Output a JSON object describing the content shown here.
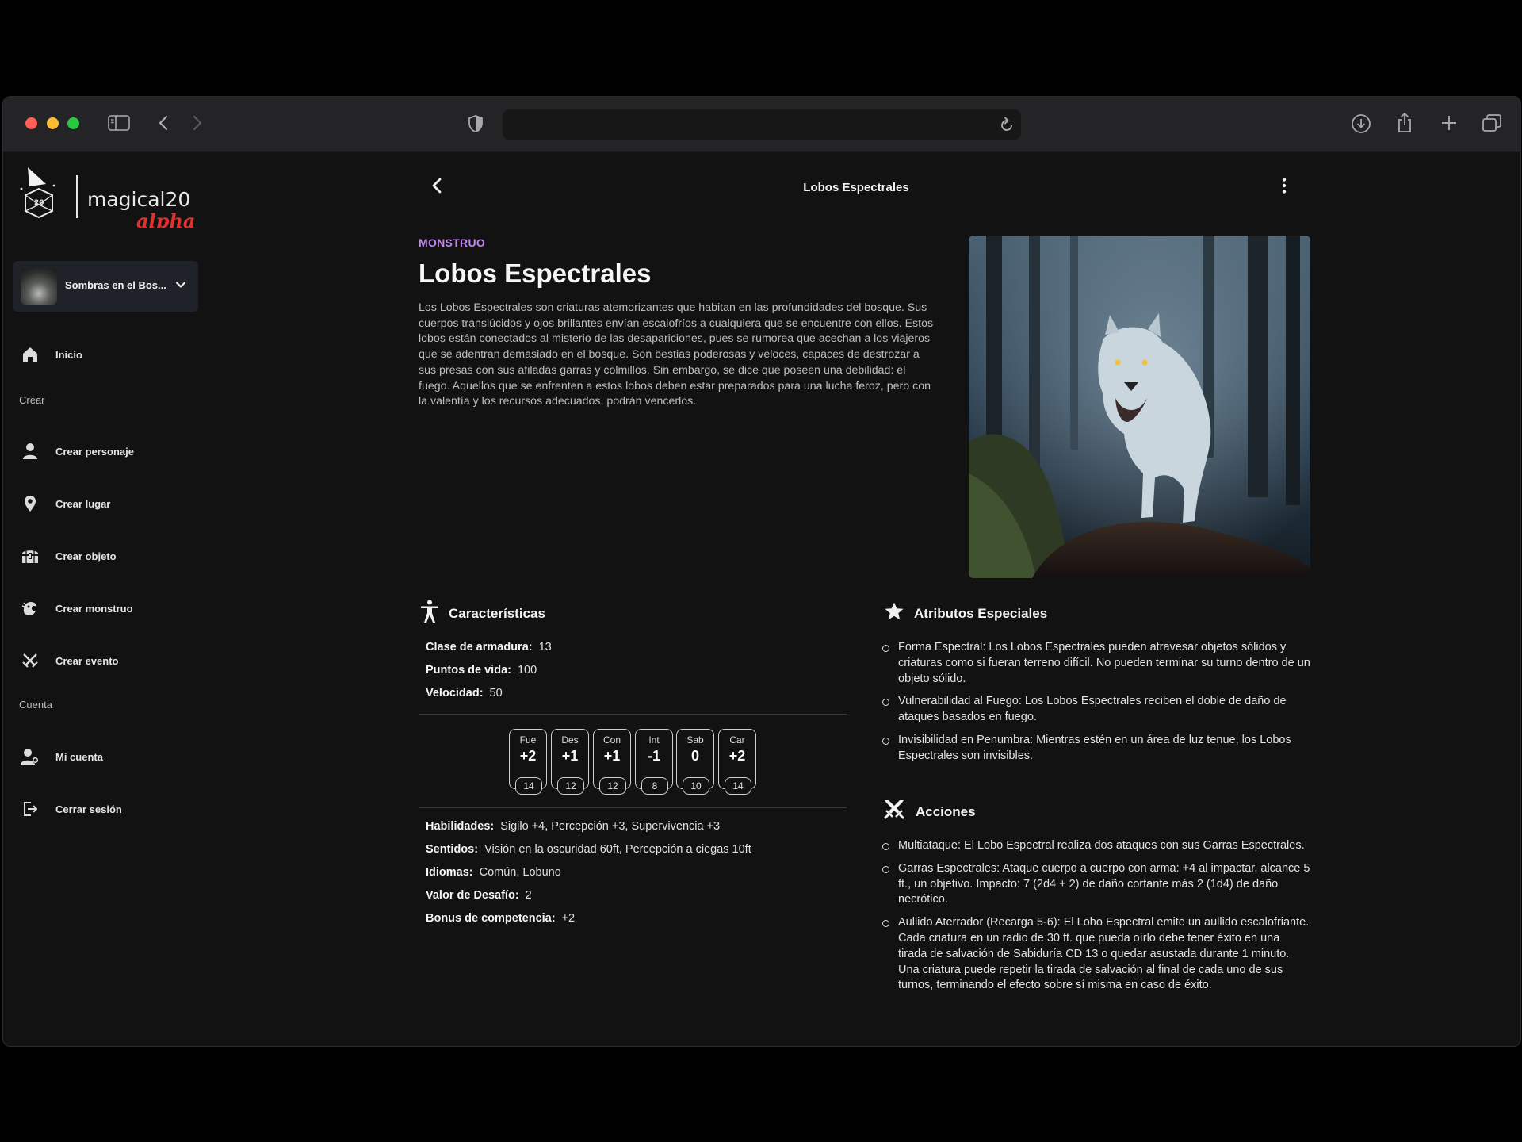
{
  "browser": {
    "url": ""
  },
  "app": {
    "logo_text": "magical20",
    "logo_tag": "alpha"
  },
  "sidebar": {
    "campaign": "Sombras en el Bos...",
    "home": "Inicio",
    "section_create": "Crear",
    "create_items": [
      {
        "label": "Crear personaje",
        "icon": "person-icon"
      },
      {
        "label": "Crear lugar",
        "icon": "location-pin-icon"
      },
      {
        "label": "Crear objeto",
        "icon": "treasure-chest-icon"
      },
      {
        "label": "Crear monstruo",
        "icon": "dragon-icon"
      },
      {
        "label": "Crear evento",
        "icon": "crossed-swords-icon"
      }
    ],
    "section_account": "Cuenta",
    "account_items": [
      {
        "label": "Mi cuenta",
        "icon": "user-settings-icon"
      },
      {
        "label": "Cerrar sesión",
        "icon": "logout-icon"
      }
    ]
  },
  "header": {
    "title": "Lobos Espectrales"
  },
  "monster": {
    "type": "MONSTRUO",
    "name": "Lobos Espectrales",
    "description": "Los Lobos Espectrales son criaturas atemorizantes que habitan en las profundidades del bosque. Sus cuerpos translúcidos y ojos brillantes envían escalofríos a cualquiera que se encuentre con ellos. Estos lobos están conectados al misterio de las desapariciones, pues se rumorea que acechan a los viajeros que se adentran demasiado en el bosque. Son bestias poderosas y veloces, capaces de destrozar a sus presas con sus afiladas garras y colmillos. Sin embargo, se dice que poseen una debilidad: el fuego. Aquellos que se enfrenten a estos lobos deben estar preparados para una lucha feroz, pero con la valentía y los recursos adecuados, podrán vencerlos."
  },
  "characteristics": {
    "title": "Características",
    "armor": {
      "label": "Clase de armadura:",
      "value": "13"
    },
    "hp": {
      "label": "Puntos de vida:",
      "value": "100"
    },
    "speed": {
      "label": "Velocidad:",
      "value": "50"
    },
    "abilities": [
      {
        "abbr": "Fue",
        "mod": "+2",
        "score": "14"
      },
      {
        "abbr": "Des",
        "mod": "+1",
        "score": "12"
      },
      {
        "abbr": "Con",
        "mod": "+1",
        "score": "12"
      },
      {
        "abbr": "Int",
        "mod": "-1",
        "score": "8"
      },
      {
        "abbr": "Sab",
        "mod": "0",
        "score": "10"
      },
      {
        "abbr": "Car",
        "mod": "+2",
        "score": "14"
      }
    ],
    "skills": {
      "label": "Habilidades:",
      "value": "Sigilo +4, Percepción +3, Supervivencia +3"
    },
    "senses": {
      "label": "Sentidos:",
      "value": "Visión en la oscuridad 60ft, Percepción a ciegas 10ft"
    },
    "languages": {
      "label": "Idiomas:",
      "value": "Común, Lobuno"
    },
    "challenge": {
      "label": "Valor de Desafío:",
      "value": "2"
    },
    "proficiency": {
      "label": "Bonus de competencia:",
      "value": "+2"
    }
  },
  "special": {
    "title": "Atributos Especiales",
    "items": [
      "Forma Espectral: Los Lobos Espectrales pueden atravesar objetos sólidos y criaturas como si fueran terreno difícil. No pueden terminar su turno dentro de un objeto sólido.",
      "Vulnerabilidad al Fuego: Los Lobos Espectrales reciben el doble de daño de ataques basados en fuego.",
      "Invisibilidad en Penumbra: Mientras estén en un área de luz tenue, los Lobos Espectrales son invisibles."
    ]
  },
  "actions": {
    "title": "Acciones",
    "items": [
      "Multiataque: El Lobo Espectral realiza dos ataques con sus Garras Espectrales.",
      "Garras Espectrales: Ataque cuerpo a cuerpo con arma: +4 al impactar, alcance 5 ft., un objetivo. Impacto: 7 (2d4 + 2) de daño cortante más 2 (1d4) de daño necrótico.",
      "Aullido Aterrador (Recarga 5-6): El Lobo Espectral emite un aullido escalofriante. Cada criatura en un radio de 30 ft. que pueda oírlo debe tener éxito en una tirada de salvación de Sabiduría CD 13 o quedar asustada durante 1 minuto. Una criatura puede repetir la tirada de salvación al final de cada uno de sus turnos, terminando el efecto sobre sí misma en caso de éxito."
    ]
  },
  "colors": {
    "accent": "#c286f0",
    "logo_red": "#e0312f",
    "panel": "#1f2329",
    "background": "#121212"
  }
}
